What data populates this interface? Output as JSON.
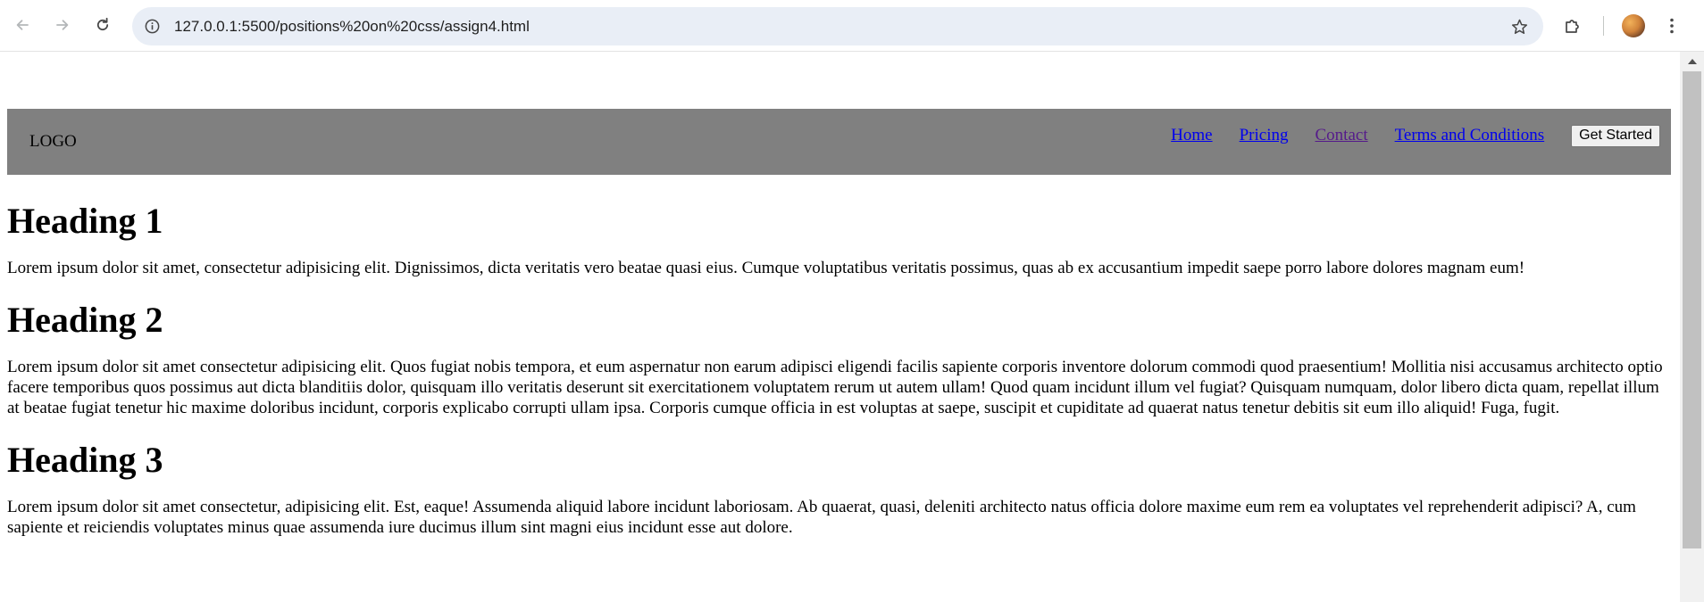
{
  "browser": {
    "url": "127.0.0.1:5500/positions%20on%20css/assign4.html",
    "icons": {
      "back": "arrow-left-icon",
      "forward": "arrow-right-icon",
      "reload": "reload-icon",
      "site_info": "info-icon",
      "bookmark": "star-icon",
      "extensions": "puzzle-icon",
      "menu": "kebab-menu-icon"
    }
  },
  "header": {
    "logo": "LOGO",
    "nav": [
      "Home",
      "Pricing",
      "Contact",
      "Terms and Conditions"
    ],
    "cta": "Get Started",
    "background_color": "#808080",
    "link_color": "#0000ee",
    "visited_link_color": "#551a8b"
  },
  "sections": [
    {
      "heading": "Heading 1",
      "text": "Lorem ipsum dolor sit amet, consectetur adipisicing elit. Dignissimos, dicta veritatis vero beatae quasi eius. Cumque voluptatibus veritatis possimus, quas ab ex accusantium impedit saepe porro labore dolores magnam eum!"
    },
    {
      "heading": "Heading 2",
      "text": "Lorem ipsum dolor sit amet consectetur adipisicing elit. Quos fugiat nobis tempora, et eum aspernatur non earum adipisci eligendi facilis sapiente corporis inventore dolorum commodi quod praesentium! Mollitia nisi accusamus architecto optio facere temporibus quos possimus aut dicta blanditiis dolor, quisquam illo veritatis deserunt sit exercitationem voluptatem rerum ut autem ullam! Quod quam incidunt illum vel fugiat? Quisquam numquam, dolor libero dicta quam, repellat illum at beatae fugiat tenetur hic maxime doloribus incidunt, corporis explicabo corrupti ullam ipsa. Corporis cumque officia in est voluptas at saepe, suscipit et cupiditate ad quaerat natus tenetur debitis sit eum illo aliquid! Fuga, fugit."
    },
    {
      "heading": "Heading 3",
      "text": "Lorem ipsum dolor sit amet consectetur, adipisicing elit. Est, eaque! Assumenda aliquid labore incidunt laboriosam. Ab quaerat, quasi, deleniti architecto natus officia dolore maxime eum rem ea voluptates vel reprehenderit adipisci? A, cum sapiente et reiciendis voluptates minus quae assumenda iure ducimus illum sint magni eius incidunt esse aut dolore."
    }
  ]
}
